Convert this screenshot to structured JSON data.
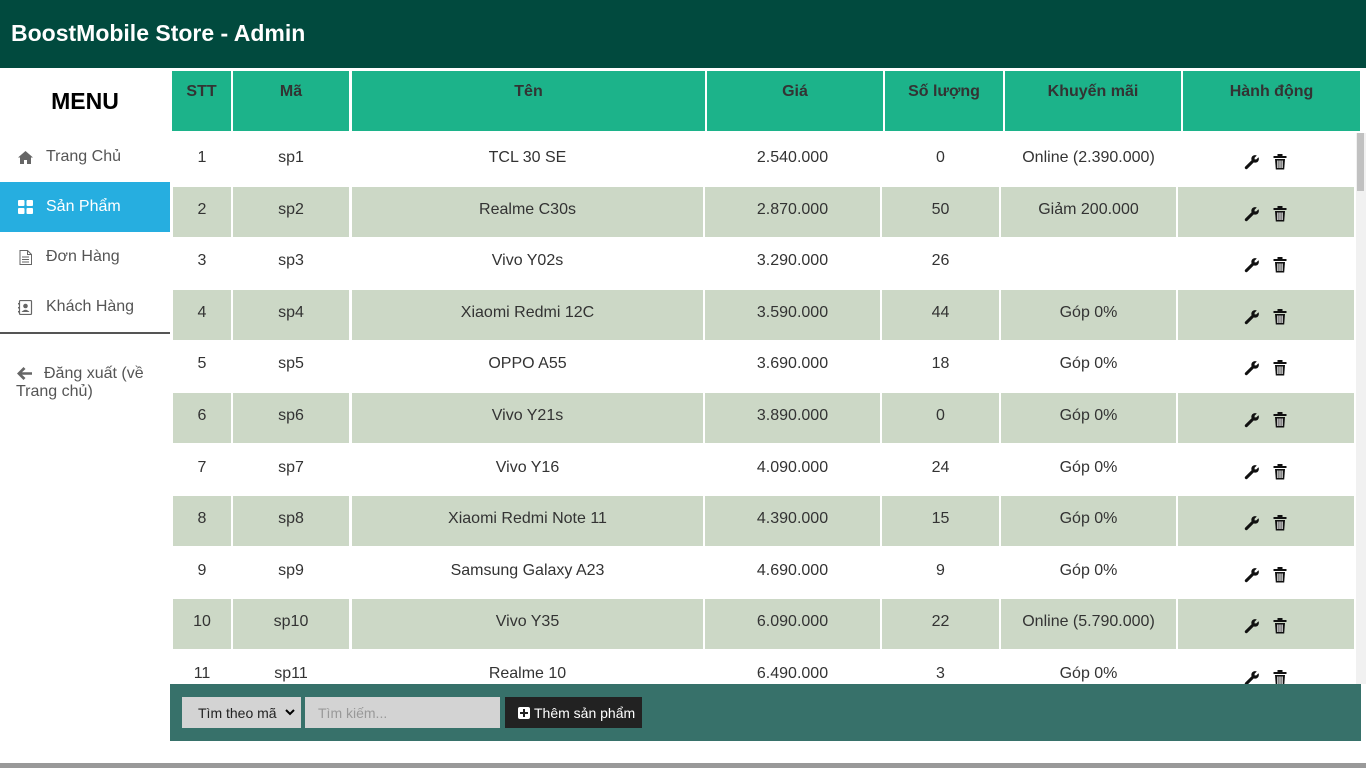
{
  "header": {
    "title": "BoostMobile Store - Admin"
  },
  "sidebar": {
    "title": "MENU",
    "items": [
      {
        "label": "Trang Chủ",
        "icon": "home-icon"
      },
      {
        "label": "Sản Phẩm",
        "icon": "grid-icon",
        "active": true
      },
      {
        "label": "Đơn Hàng",
        "icon": "document-icon"
      },
      {
        "label": "Khách Hàng",
        "icon": "contact-icon"
      }
    ],
    "logout_label": "Đăng xuất (về Trang chủ)"
  },
  "table": {
    "columns": [
      "STT",
      "Mã",
      "Tên",
      "Giá",
      "Số lượng",
      "Khuyến mãi",
      "Hành động"
    ],
    "rows": [
      [
        "1",
        "sp1",
        "TCL 30 SE",
        "2.540.000",
        "0",
        "Online (2.390.000)"
      ],
      [
        "2",
        "sp2",
        "Realme C30s",
        "2.870.000",
        "50",
        "Giảm 200.000"
      ],
      [
        "3",
        "sp3",
        "Vivo Y02s",
        "3.290.000",
        "26",
        ""
      ],
      [
        "4",
        "sp4",
        "Xiaomi Redmi 12C",
        "3.590.000",
        "44",
        "Góp 0%"
      ],
      [
        "5",
        "sp5",
        "OPPO A55",
        "3.690.000",
        "18",
        "Góp 0%"
      ],
      [
        "6",
        "sp6",
        "Vivo Y21s",
        "3.890.000",
        "0",
        "Góp 0%"
      ],
      [
        "7",
        "sp7",
        "Vivo Y16",
        "4.090.000",
        "24",
        "Góp 0%"
      ],
      [
        "8",
        "sp8",
        "Xiaomi Redmi Note 11",
        "4.390.000",
        "15",
        "Góp 0%"
      ],
      [
        "9",
        "sp9",
        "Samsung Galaxy A23",
        "4.690.000",
        "9",
        "Góp 0%"
      ],
      [
        "10",
        "sp10",
        "Vivo Y35",
        "6.090.000",
        "22",
        "Online (5.790.000)"
      ],
      [
        "11",
        "sp11",
        "Realme 10",
        "6.490.000",
        "3",
        "Góp 0%"
      ]
    ]
  },
  "toolbar": {
    "search_mode": "Tìm theo mã",
    "search_placeholder": "Tìm kiếm...",
    "add_label": "Thêm sản phẩm"
  },
  "colors": {
    "header_bg": "#014a3e",
    "table_header_bg": "#1cb38a",
    "active_nav_bg": "#26aee0",
    "alt_row_bg": "#ccd8c6",
    "bottom_bar_bg": "#37716a"
  }
}
